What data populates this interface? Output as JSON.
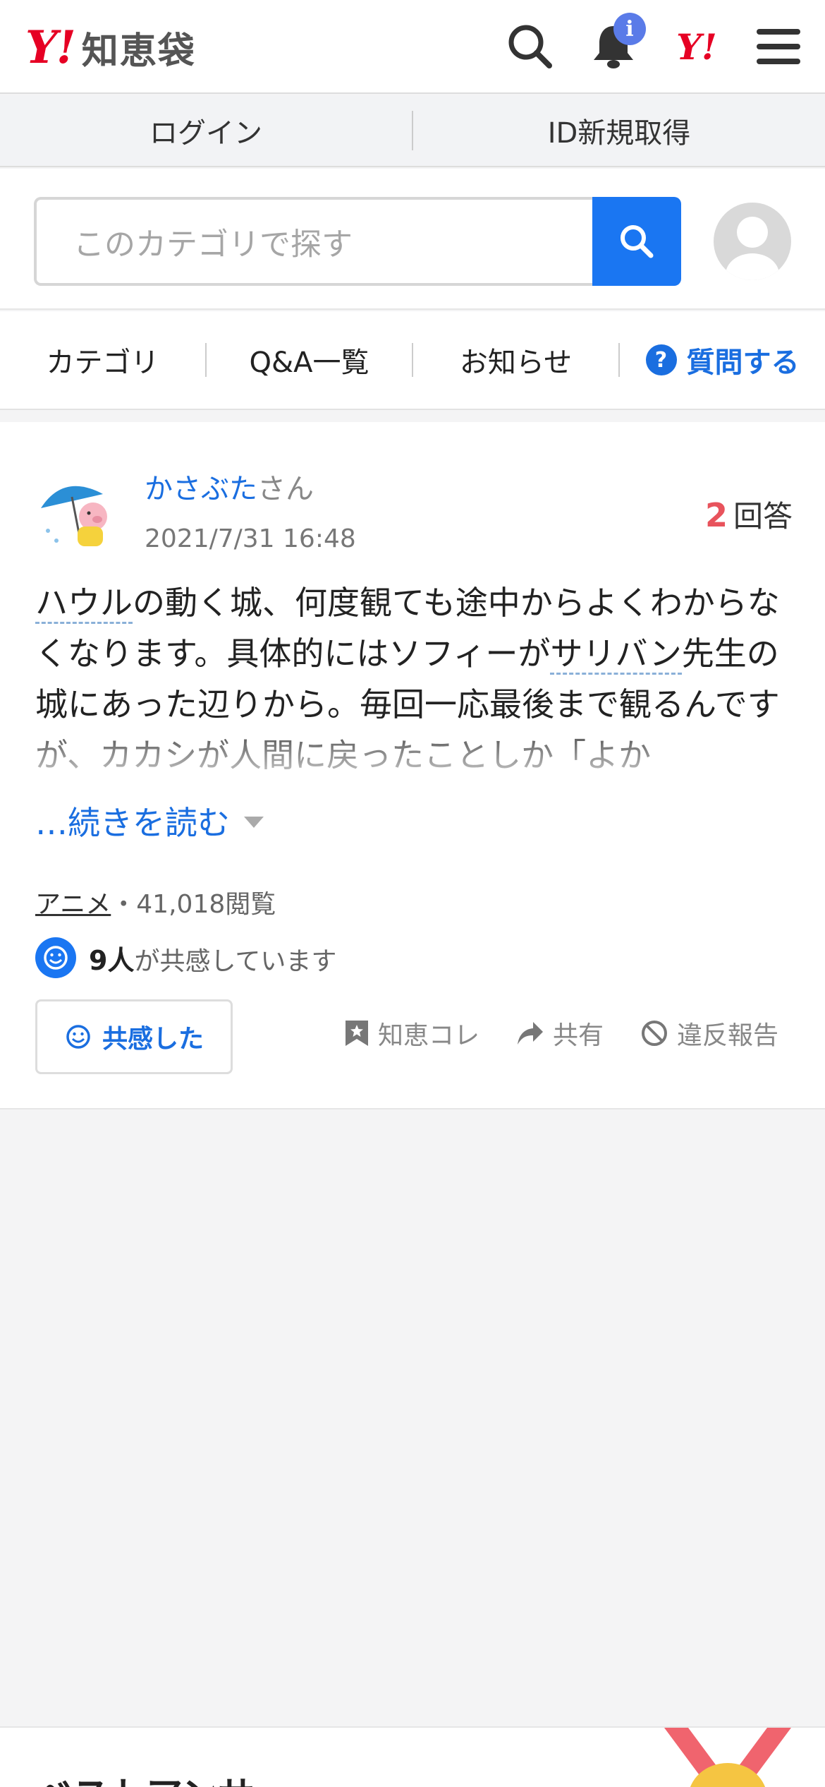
{
  "header": {
    "logo_mark": "Y!",
    "logo_text": "知恵袋",
    "notification_badge": "i",
    "yahoo_mark": "Y!"
  },
  "loginbar": {
    "login": "ログイン",
    "register": "ID新規取得"
  },
  "search": {
    "placeholder": "このカテゴリで探す"
  },
  "tabs": {
    "category": "カテゴリ",
    "qa_list": "Q&A一覧",
    "news": "お知らせ",
    "ask_icon": "?",
    "ask": "質問する"
  },
  "question": {
    "user_name": "かさぶた",
    "user_suffix": "さん",
    "date": "2021/7/31 16:48",
    "answers_count": "2",
    "answers_label": "回答",
    "text_part1": "ハウル",
    "text_part2": "の動く城、何度観ても途中からよくわからなくなります。具体的にはソフィーが",
    "text_part3": "サリバン",
    "text_part4": "先生の城にあった辺りから。毎回一応最後まで観るんですが、カカシが人間に戻ったことしか「よか",
    "read_more": "…続きを読む",
    "category": "アニメ",
    "views": "・41,018閲覧",
    "empathy_count": "9人",
    "empathy_text": "が共感しています",
    "empathy_button": "共感した",
    "action_collect": "知恵コレ",
    "action_share": "共有",
    "action_report": "違反報告"
  },
  "best_answer": {
    "title": "ベストアンサー"
  },
  "colors": {
    "brand_red": "#e60024",
    "link_blue": "#1a6ee0",
    "search_blue": "#1a76f2",
    "answer_count_red": "#e8535c"
  }
}
